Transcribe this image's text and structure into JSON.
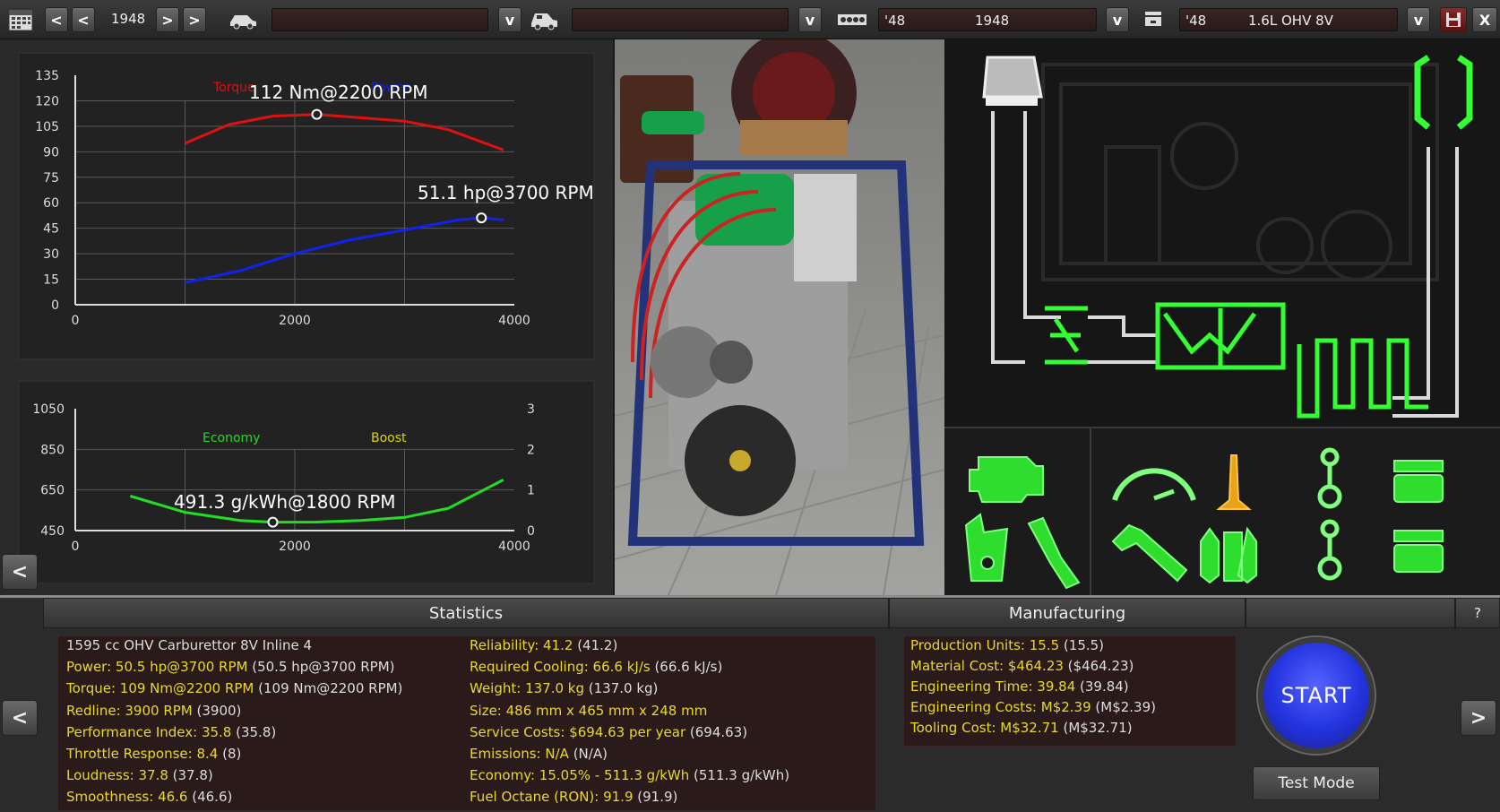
{
  "toolbar": {
    "year": "1948",
    "prev_label": "<",
    "next_label": ">",
    "dropdown_label": "v",
    "car_field": "",
    "trim_field": "",
    "engine_family_year_short": "'48",
    "engine_family_year": "1948",
    "engine_variant_year_short": "'48",
    "engine_variant_name": "1.6L OHV 8V",
    "close_label": "X"
  },
  "colors": {
    "torque": "#dd1111",
    "power": "#1122ee",
    "economy": "#22dd22",
    "boost": "#d8d800",
    "stat_key": "#e8d830",
    "start": "#2233dd",
    "schematic_green": "#33ff33"
  },
  "torque_chart": {
    "legend_torque": "Torque",
    "legend_power": "Power",
    "torque_annotation": "112 Nm@2200 RPM",
    "power_annotation": "51.1 hp@3700 RPM",
    "y_ticks": [
      "135",
      "120",
      "105",
      "90",
      "75",
      "60",
      "45",
      "30",
      "15",
      "0"
    ],
    "x_ticks": [
      "0",
      "2000",
      "4000"
    ]
  },
  "economy_chart": {
    "legend_economy": "Economy",
    "legend_boost": "Boost",
    "annotation": "491.3 g/kWh@1800 RPM",
    "y_ticks_left": [
      "1050",
      "850",
      "650",
      "450"
    ],
    "y_ticks_right": [
      "3",
      "2",
      "1",
      "0"
    ],
    "x_ticks": [
      "0",
      "2000",
      "4000"
    ]
  },
  "chart_data": [
    {
      "type": "line",
      "xlim": [
        0,
        4000
      ],
      "ylim": [
        0,
        135
      ],
      "grid": true,
      "series": [
        {
          "name": "Torque",
          "x": [
            1000,
            1400,
            1800,
            2200,
            2600,
            3000,
            3400,
            3900
          ],
          "values": [
            95,
            106,
            111,
            112,
            110,
            108,
            103,
            91
          ]
        },
        {
          "name": "Power",
          "x": [
            1000,
            1500,
            2000,
            2500,
            3000,
            3500,
            3700,
            3900
          ],
          "values": [
            13,
            20,
            30,
            38,
            44,
            50,
            51.1,
            50
          ]
        }
      ]
    },
    {
      "type": "line",
      "xlim": [
        0,
        4000
      ],
      "ylim": [
        450,
        1050
      ],
      "grid": true,
      "series": [
        {
          "name": "Economy",
          "x": [
            500,
            1000,
            1500,
            1800,
            2200,
            2600,
            3000,
            3400,
            3900
          ],
          "values": [
            620,
            540,
            500,
            491.3,
            492,
            500,
            515,
            560,
            700
          ]
        }
      ]
    }
  ],
  "statistics": {
    "header": "Statistics",
    "left": [
      {
        "key": "1595 cc OHV Carburettor 8V Inline 4",
        "val": ""
      },
      {
        "key": "Power: 50.5 hp@3700 RPM",
        "val": " (50.5 hp@3700 RPM)"
      },
      {
        "key": "Torque: 109 Nm@2200 RPM",
        "val": " (109 Nm@2200 RPM)"
      },
      {
        "key": "Redline: 3900 RPM",
        "val": " (3900)"
      },
      {
        "key": "Performance Index: 35.8",
        "val": " (35.8)"
      },
      {
        "key": "Throttle Response: 8.4",
        "val": " (8)"
      },
      {
        "key": "Loudness: 37.8",
        "val": " (37.8)"
      },
      {
        "key": "Smoothness: 46.6",
        "val": " (46.6)"
      }
    ],
    "right": [
      {
        "key": "Reliability: 41.2",
        "val": " (41.2)"
      },
      {
        "key": "Required Cooling: 66.6 kJ/s",
        "val": " (66.6 kJ/s)"
      },
      {
        "key": "Weight: 137.0 kg",
        "val": " (137.0 kg)"
      },
      {
        "key": "Size: 486 mm x 465 mm x 248 mm",
        "val": ""
      },
      {
        "key": "Service Costs: $694.63 per year",
        "val": " (694.63)"
      },
      {
        "key": "Emissions: N/A",
        "val": " (N/A)"
      },
      {
        "key": "Economy: 15.05% - 511.3 g/kWh",
        "val": " (511.3 g/kWh)"
      },
      {
        "key": "Fuel Octane (RON): 91.9",
        "val": " (91.9)"
      }
    ]
  },
  "manufacturing": {
    "header": "Manufacturing",
    "rows": [
      {
        "key": "Production Units: 15.5",
        "val": " (15.5)"
      },
      {
        "key": "Material Cost: $464.23",
        "val": " ($464.23)"
      },
      {
        "key": "Engineering Time: 39.84",
        "val": " (39.84)"
      },
      {
        "key": "Engineering Costs: M$2.39",
        "val": " (M$2.39)"
      },
      {
        "key": "Tooling Cost: M$32.71",
        "val": " (M$32.71)"
      }
    ]
  },
  "actions": {
    "start_label": "START",
    "test_mode_label": "Test Mode",
    "help_label": "?",
    "back_label": "<",
    "forward_label": ">"
  }
}
